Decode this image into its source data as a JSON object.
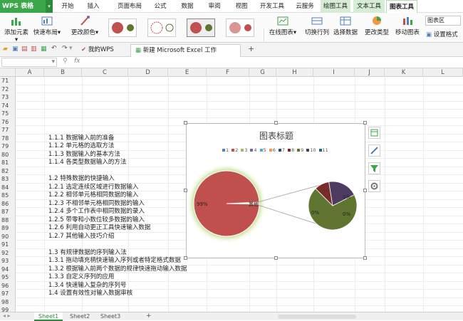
{
  "app": {
    "logo_label": "WPS 表格"
  },
  "menu_tabs": [
    "开始",
    "插入",
    "页面布局",
    "公式",
    "数据",
    "审阅",
    "视图",
    "开发工具",
    "云服务",
    "绘图工具",
    "文本工具",
    "图表工具"
  ],
  "ribbon": {
    "add_element": "添加元素",
    "quick_layout": "快速布局",
    "change_color": "更改颜色",
    "online_chart": "在线图表",
    "switch_row_col": "切换行列",
    "select_data": "选择数据",
    "change_type": "更改类型",
    "move_chart": "移动图表",
    "chart_area_select": "图表区",
    "set_format": "设置格式"
  },
  "doc_tabs": {
    "mywps": "我的WPS",
    "file": "新建 Microsoft Excel 工作表.xlsx *",
    "new_tab": "+"
  },
  "formula_bar": {
    "fx": "fx",
    "name_box": ""
  },
  "columns": [
    "A",
    "B",
    "C",
    "D",
    "E",
    "F",
    "G",
    "H",
    "I",
    "J",
    "K",
    "L"
  ],
  "rows": [
    {
      "n": "71",
      "text": ""
    },
    {
      "n": "72",
      "text": ""
    },
    {
      "n": "73",
      "text": ""
    },
    {
      "n": "74",
      "text": ""
    },
    {
      "n": "75",
      "text": ""
    },
    {
      "n": "76",
      "text": ""
    },
    {
      "n": "77",
      "text": ""
    },
    {
      "n": "78",
      "text": "1.1.1 数据输入前的准备"
    },
    {
      "n": "79",
      "text": "1.1.2 单元格的选取方法"
    },
    {
      "n": "80",
      "text": "1.1.3 数据输入的基本方法"
    },
    {
      "n": "81",
      "text": "1.1.4 各类型数据输入的方法"
    },
    {
      "n": "82",
      "text": ""
    },
    {
      "n": "83",
      "text": "1.2 特殊数据的快捷输入"
    },
    {
      "n": "84",
      "text": "1.2.1 选定连续区域进行数据输入"
    },
    {
      "n": "85",
      "text": "1.2.2 相邻单元格相同数据的输入"
    },
    {
      "n": "86",
      "text": "1.2.3 不相邻单元格相同数据的输入"
    },
    {
      "n": "87",
      "text": "1.2.4 多个工作表中相同数据的录入"
    },
    {
      "n": "88",
      "text": "1.2.5 带零和小数位较多数据的输入"
    },
    {
      "n": "89",
      "text": "1.2.6 利用自动更正工具快速输入数据"
    },
    {
      "n": "90",
      "text": "1.2.7 其他输入技巧介绍"
    },
    {
      "n": "91",
      "text": ""
    },
    {
      "n": "92",
      "text": "1.3 有规律数据的序列输入法"
    },
    {
      "n": "93",
      "text": "1.3.1 拖动填充柄快速输入序列或者特定格式数据"
    },
    {
      "n": "94",
      "text": "1.3.2 根据输入前两个数据的规律快速拖动输入数据"
    },
    {
      "n": "95",
      "text": "1.3.3 自定义序列的应用"
    },
    {
      "n": "96",
      "text": "1.3.4 快速输入复杂的序列号"
    },
    {
      "n": "97",
      "text": "1.4 设置有效性对输入数据审核"
    },
    {
      "n": "98",
      "text": ""
    },
    {
      "n": "99",
      "text": ""
    }
  ],
  "chart_data": {
    "type": "pie",
    "title": "图表标题",
    "legend": [
      "1",
      "2",
      "3",
      "4",
      "5",
      "6",
      "7",
      "8",
      "9",
      "10",
      "11"
    ],
    "legend_colors": [
      "#4f81bd",
      "#c0504d",
      "#9bbb59",
      "#8064a2",
      "#4bacc6",
      "#f79646",
      "#2c4d75",
      "#772c2a",
      "#5f7530",
      "#4d3b62",
      "#276a7c"
    ],
    "main_pie": {
      "label": "99%",
      "percent": 99,
      "color": "#c0504d"
    },
    "secondary_pie": {
      "labels": [
        "0%",
        "0%",
        "0%"
      ],
      "slices": [
        {
          "value": 70,
          "color": "#5f7530"
        },
        {
          "value": 10,
          "color": "#772c2a"
        },
        {
          "value": 20,
          "color": "#4d3b62"
        }
      ]
    },
    "other_label": "其他",
    "legend_position": "top"
  },
  "sheets": [
    "Sheet1",
    "Sheet2",
    "Sheet3"
  ]
}
